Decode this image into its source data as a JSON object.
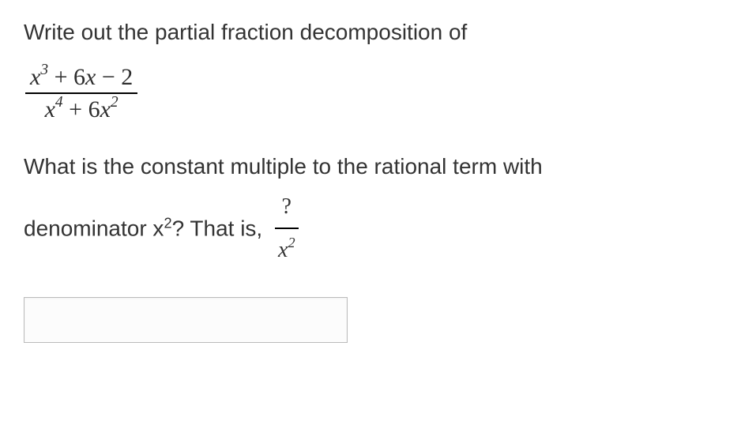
{
  "question": {
    "intro": "Write out the partial fraction decomposition of",
    "expression": {
      "numerator_parts": {
        "var1": "x",
        "exp1": "3",
        "op1": " + ",
        "coef2": "6",
        "var2": "x",
        "op2": " − ",
        "const": "2"
      },
      "denominator_parts": {
        "var1": "x",
        "exp1": "4",
        "op1": " + ",
        "coef2": "6",
        "var2": "x",
        "exp2": "2"
      }
    },
    "part2_line1": "What is the constant multiple to the rational term with",
    "part2_line2_prefix": "denominator x",
    "part2_line2_exp": "2",
    "part2_line2_mid": "? That is, ",
    "inline_fraction": {
      "numerator": "?",
      "denom_var": "x",
      "denom_exp": "2"
    }
  },
  "input": {
    "value": ""
  }
}
